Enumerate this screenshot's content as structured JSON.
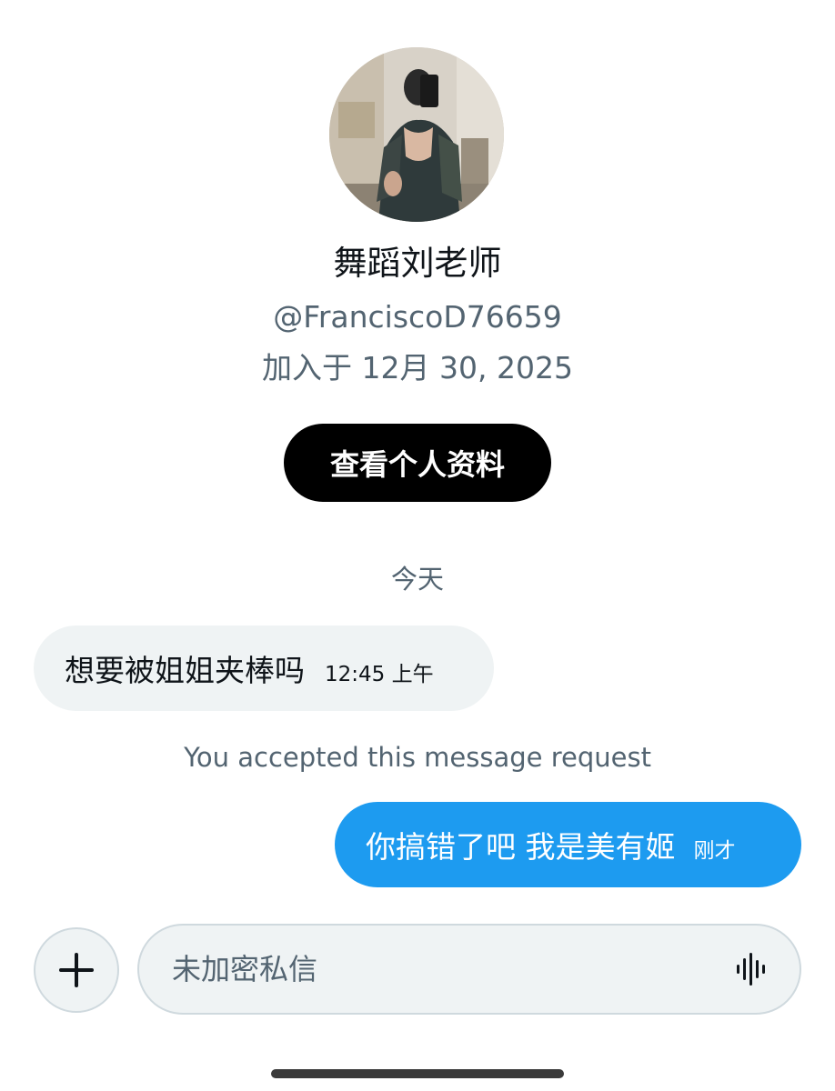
{
  "profile": {
    "display_name": "舞蹈刘老师",
    "handle": "@FranciscoD76659",
    "joined": "加入于 12月 30, 2025",
    "view_profile_label": "查看个人资料"
  },
  "conversation": {
    "date_separator": "今天",
    "messages": [
      {
        "direction": "incoming",
        "text": "想要被姐姐夹棒吗",
        "time": "12:45 上午"
      },
      {
        "direction": "outgoing",
        "text": "你搞错了吧 我是美有姬",
        "time": "刚才"
      }
    ],
    "system_note": "You accepted this message request"
  },
  "composer": {
    "placeholder": "未加密私信",
    "add_icon": "plus-icon",
    "voice_icon": "voice-waveform-icon"
  },
  "colors": {
    "outgoing_bubble": "#1d9bf0",
    "incoming_bubble": "#eff3f4",
    "primary_button": "#000000",
    "secondary_text": "#536471",
    "primary_text": "#0f1419"
  }
}
